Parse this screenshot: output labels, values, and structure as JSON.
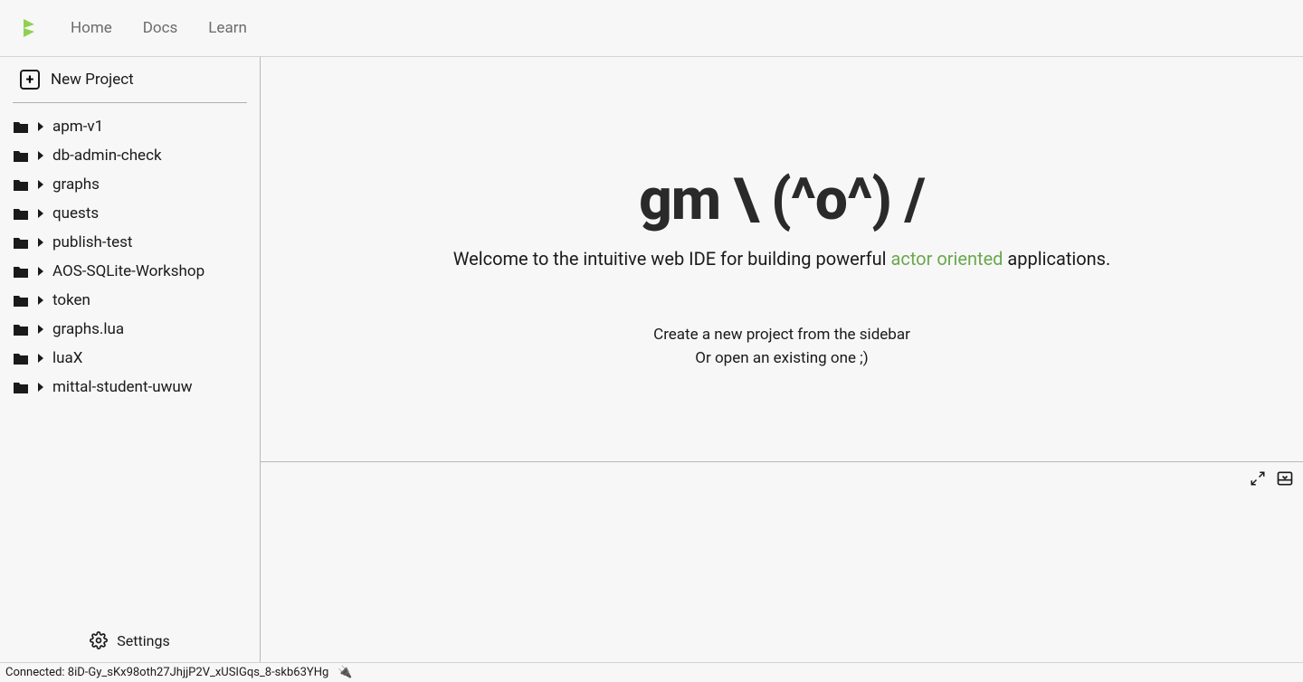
{
  "nav": {
    "home": "Home",
    "docs": "Docs",
    "learn": "Learn"
  },
  "sidebar": {
    "new_project": "New Project",
    "settings": "Settings",
    "projects": [
      {
        "name": "apm-v1"
      },
      {
        "name": "db-admin-check"
      },
      {
        "name": "graphs"
      },
      {
        "name": "quests"
      },
      {
        "name": "publish-test"
      },
      {
        "name": "AOS-SQLite-Workshop"
      },
      {
        "name": "token"
      },
      {
        "name": "graphs.lua"
      },
      {
        "name": "luaX"
      },
      {
        "name": "mittal-student-uwuw"
      }
    ]
  },
  "welcome": {
    "heading": "gm \\ (^o^) /",
    "subtitle_pre": "Welcome to the intuitive web IDE for building powerful ",
    "subtitle_link": "actor oriented",
    "subtitle_post": " applications.",
    "hint_line1": "Create a new project from the sidebar",
    "hint_line2": "Or open an existing one ;)"
  },
  "status": {
    "connected_label": "Connected: ",
    "connected_id": "8iD-Gy_sKx98oth27JhjjP2V_xUSIGqs_8-skb63YHg"
  },
  "colors": {
    "accent": "#6aa84f",
    "logo": "#8FD14F"
  }
}
